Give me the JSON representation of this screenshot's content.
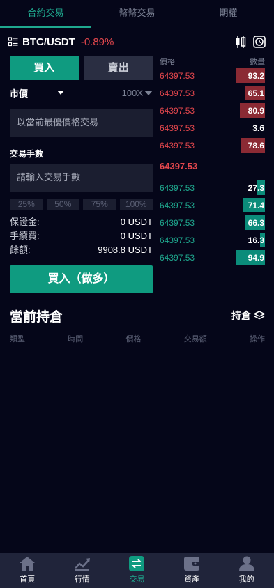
{
  "tabs": [
    {
      "label": "合約交易",
      "active": true
    },
    {
      "label": "幣幣交易",
      "active": false
    },
    {
      "label": "期權",
      "active": false
    }
  ],
  "pair": {
    "symbol": "BTC/USDT",
    "change": "-0.89%"
  },
  "trade": {
    "buy_label": "買入",
    "sell_label": "賣出",
    "order_type": "市價",
    "leverage": "100X",
    "price_placeholder": "以當前最優價格交易",
    "qty_label": "交易手數",
    "qty_placeholder": "請輸入交易手數",
    "pcts": [
      "25%",
      "50%",
      "75%",
      "100%"
    ],
    "margin_label": "保證金:",
    "margin_value": "0 USDT",
    "fee_label": "手續費:",
    "fee_value": "0 USDT",
    "balance_label": "餘額:",
    "balance_value": "9908.8 USDT",
    "submit_label": "買入（做多）"
  },
  "book": {
    "price_header": "價格",
    "qty_header": "數量",
    "asks": [
      {
        "price": "64397.53",
        "qty": "93.2",
        "depth": 0.93
      },
      {
        "price": "64397.53",
        "qty": "65.1",
        "depth": 0.65
      },
      {
        "price": "64397.53",
        "qty": "80.9",
        "depth": 0.81
      },
      {
        "price": "64397.53",
        "qty": "3.6",
        "depth": 0.0
      },
      {
        "price": "64397.53",
        "qty": "78.6",
        "depth": 0.79
      }
    ],
    "last_price": "64397.53",
    "bids": [
      {
        "price": "64397.53",
        "qty": "27.3",
        "depth": 0.27
      },
      {
        "price": "64397.53",
        "qty": "71.4",
        "depth": 0.71
      },
      {
        "price": "64397.53",
        "qty": "66.3",
        "depth": 0.66
      },
      {
        "price": "64397.53",
        "qty": "16.3",
        "depth": 0.16
      },
      {
        "price": "64397.53",
        "qty": "94.9",
        "depth": 0.95
      }
    ]
  },
  "positions": {
    "title": "當前持倉",
    "link": "持倉",
    "columns": [
      "類型",
      "時間",
      "價格",
      "交易額",
      "操作"
    ]
  },
  "nav": [
    {
      "label": "首頁",
      "icon": "home-icon",
      "active": false
    },
    {
      "label": "行情",
      "icon": "chart-icon",
      "active": false
    },
    {
      "label": "交易",
      "icon": "swap-icon",
      "active": true
    },
    {
      "label": "資產",
      "icon": "wallet-icon",
      "active": false
    },
    {
      "label": "我的",
      "icon": "user-icon",
      "active": false
    }
  ],
  "colors": {
    "accent": "#0f9b80",
    "down": "#e4474d",
    "ask_bar": "#8b2a34",
    "bid_bar": "#0b8c7a",
    "bg": "#050619"
  }
}
